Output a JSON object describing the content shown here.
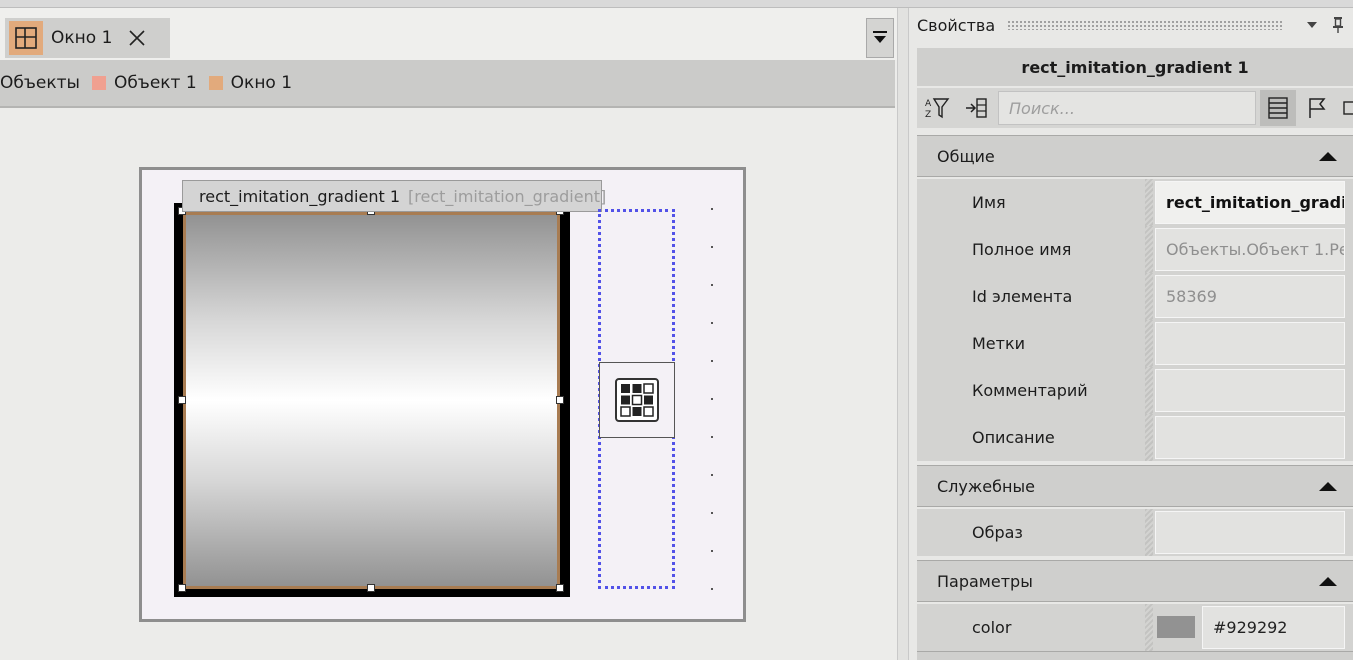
{
  "tab": {
    "label": "Окно 1",
    "icon": "layout-grid-icon",
    "accent": "#e2aa7c"
  },
  "breadcrumb": [
    {
      "label": "Объекты",
      "color": ""
    },
    {
      "label": "Объект 1",
      "color": "#f0a090"
    },
    {
      "label": "Окно 1",
      "color": "#e2aa7c"
    }
  ],
  "canvas": {
    "element_label": "rect_imitation_gradient 1",
    "element_type": "[rect_imitation_gradient]"
  },
  "props": {
    "header": "Свойства",
    "object_title": "rect_imitation_gradient 1",
    "search_placeholder": "Поиск...",
    "sections": {
      "general": {
        "label": "Общие",
        "rows": {
          "name": {
            "label": "Имя",
            "value": "rect_imitation_gradie"
          },
          "full_name": {
            "label": "Полное имя",
            "value": "Объекты.Объект 1.Ре"
          },
          "id": {
            "label": "Id элемента",
            "value": "58369"
          },
          "tags": {
            "label": "Метки",
            "value": ""
          },
          "comment": {
            "label": "Комментарий",
            "value": ""
          },
          "description": {
            "label": "Описание",
            "value": ""
          }
        }
      },
      "service": {
        "label": "Служебные",
        "rows": {
          "image": {
            "label": "Образ",
            "value": ""
          }
        }
      },
      "params": {
        "label": "Параметры",
        "rows": {
          "color": {
            "label": "color",
            "value": "#929292",
            "swatch": "#929292"
          }
        }
      }
    }
  }
}
